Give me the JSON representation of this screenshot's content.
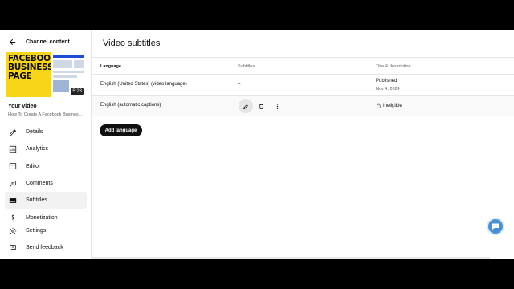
{
  "sidebar": {
    "back_label": "Channel content",
    "thumbnail": {
      "text": "FACEBOOK\nBUSINESS\nPAGE",
      "duration": "5:23"
    },
    "your_video": "Your video",
    "video_title": "How To Create A Facebook Busines...",
    "items": [
      {
        "label": "Details",
        "icon": "pencil-icon"
      },
      {
        "label": "Analytics",
        "icon": "analytics-icon"
      },
      {
        "label": "Editor",
        "icon": "editor-icon"
      },
      {
        "label": "Comments",
        "icon": "comments-icon"
      },
      {
        "label": "Subtitles",
        "icon": "subtitles-icon",
        "active": true
      },
      {
        "label": "Monetization",
        "icon": "monetization-icon"
      }
    ],
    "bottom_items": [
      {
        "label": "Settings",
        "icon": "gear-icon"
      },
      {
        "label": "Send feedback",
        "icon": "feedback-icon"
      }
    ]
  },
  "main": {
    "title": "Video subtitles",
    "columns": {
      "language": "Language",
      "subtitles": "Subtitles",
      "title_desc": "Title & description"
    },
    "rows": [
      {
        "language": "English (United States) (video language)",
        "subtitles": "–",
        "status": "Published",
        "date": "Nov 4, 2024"
      },
      {
        "language": "English (automatic captions)",
        "status": "Ineligible"
      }
    ],
    "add_language": "Add language"
  }
}
